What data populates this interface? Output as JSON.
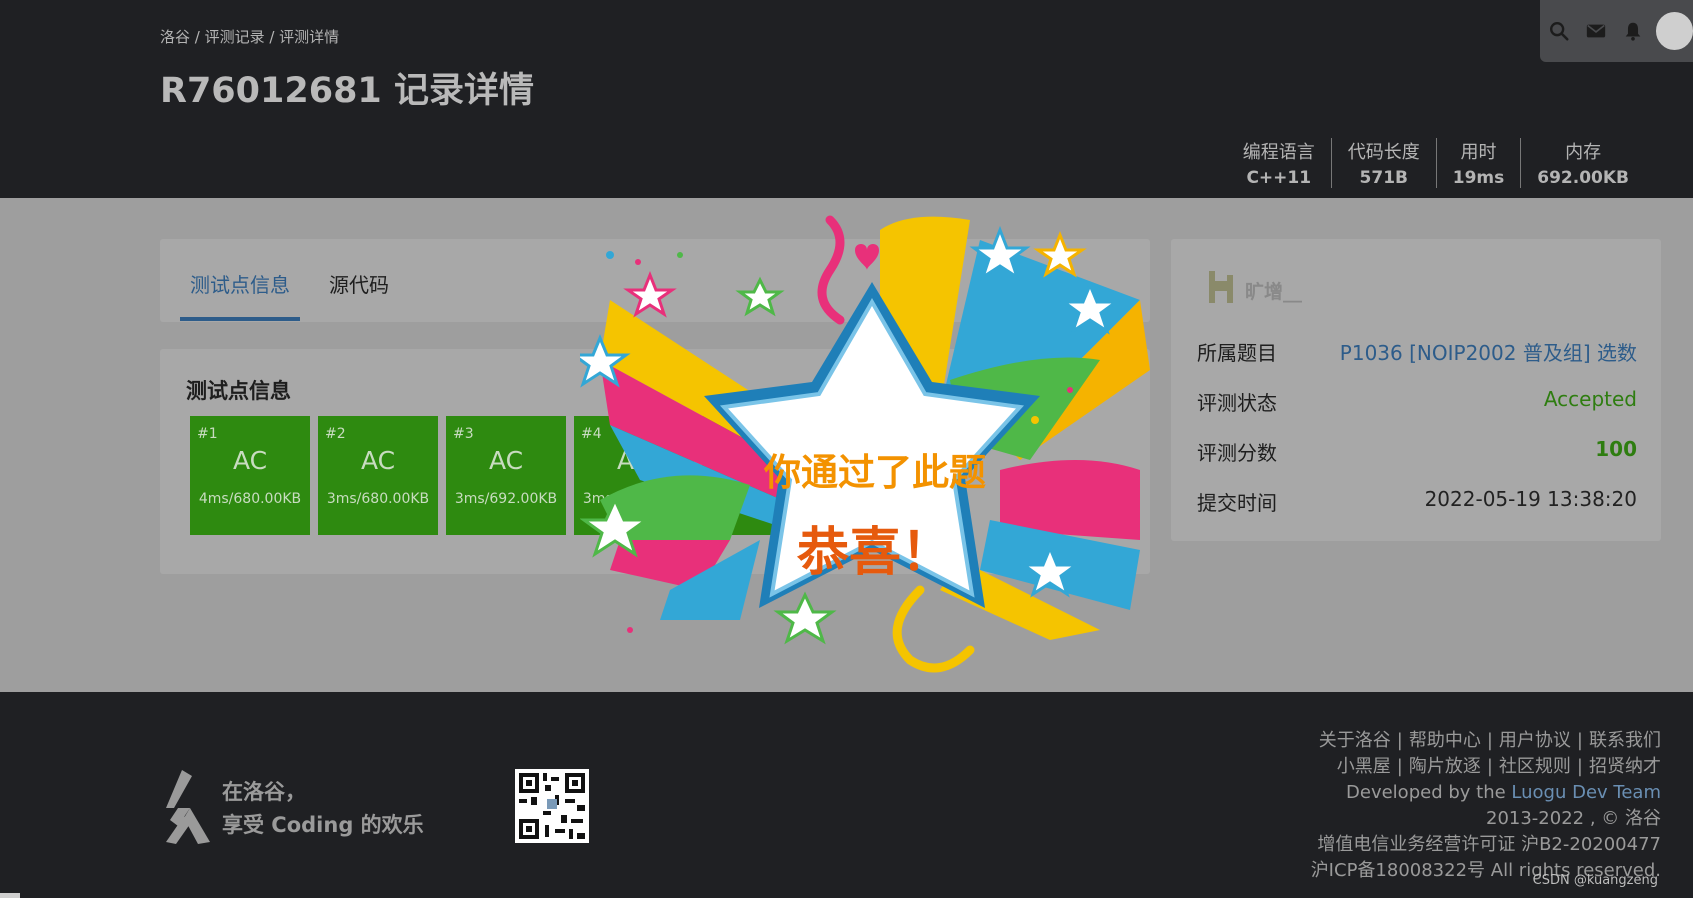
{
  "header": {
    "breadcrumb": "洛谷 / 评测记录 / 评测详情",
    "title": "R76012681 记录详情",
    "meta": [
      {
        "label": "编程语言",
        "value": "C++11"
      },
      {
        "label": "代码长度",
        "value": "571B"
      },
      {
        "label": "用时",
        "value": "19ms"
      },
      {
        "label": "内存",
        "value": "692.00KB"
      }
    ],
    "tools": [
      "search-icon",
      "mail-icon",
      "bell-icon",
      "avatar"
    ]
  },
  "tabs": {
    "active": "测试点信息",
    "source": "源代码"
  },
  "cases": {
    "title": "测试点信息",
    "items": [
      {
        "id": "#1",
        "status": "AC",
        "detail": "4ms/680.00KB"
      },
      {
        "id": "#2",
        "status": "AC",
        "detail": "3ms/680.00KB"
      },
      {
        "id": "#3",
        "status": "AC",
        "detail": "3ms/692.00KB"
      },
      {
        "id": "#4",
        "status": "AC",
        "detail": "3ms/680.00KB"
      }
    ]
  },
  "info": {
    "user": "旷增__",
    "rows": [
      {
        "label": "所属题目",
        "value": "P1036 [NOIP2002 普及组] 选数",
        "color": "#2d5c8a"
      },
      {
        "label": "评测状态",
        "value": "Accepted",
        "color": "#2e7d10"
      },
      {
        "label": "评测分数",
        "value": "100",
        "color": "#2e7d10"
      },
      {
        "label": "提交时间",
        "value": "2022-05-19 13:38:20",
        "color": "#1e1e1e"
      }
    ]
  },
  "celebration": {
    "line1": "你通过了此题",
    "line2": "恭喜！"
  },
  "footer": {
    "slogan_line1": "在洛谷，",
    "slogan_line2": "享受 Coding 的欢乐",
    "links_row1": [
      "关于洛谷",
      "帮助中心",
      "用户协议",
      "联系我们"
    ],
    "links_row2": [
      "小黑屋",
      "陶片放逐",
      "社区规则",
      "招贤纳才"
    ],
    "dev_prefix": "Developed by the",
    "dev_team": "Luogu Dev Team",
    "copyright": "2013-2022 , © 洛谷",
    "license": "增值电信业务经营许可证 沪B2-20200477",
    "icp": "沪ICP备18008322号 All rights reserved.",
    "watermark": "CSDN @kuangzeng"
  },
  "colors": {
    "accent": "#2d5c8a",
    "ac_green": "#2e8a10",
    "accepted": "#2e7d10"
  }
}
